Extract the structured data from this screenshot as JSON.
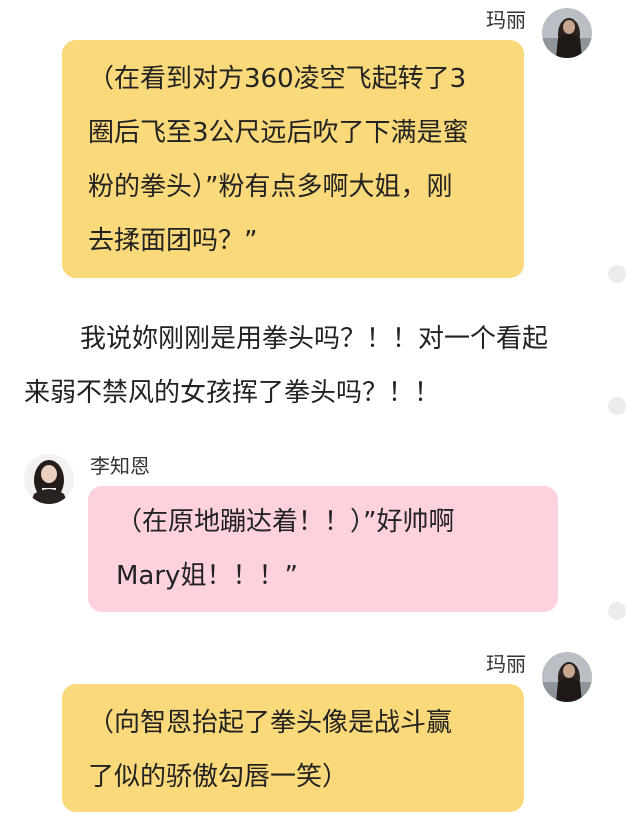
{
  "messages": [
    {
      "sender": "玛丽",
      "lines": [
        "（在看到对方360凌空飞起转了3",
        "圈后飞至3公尺远后吹了下满是蜜",
        "粉的拳头）”粉有点多啊大姐，刚",
        "去揉面团吗？”"
      ]
    },
    {
      "lines": [
        "我说妳刚刚是用拳头吗？！！对一个看起",
        "来弱不禁风的女孩挥了拳头吗？！！"
      ]
    },
    {
      "sender": "李知恩",
      "lines": [
        "（在原地蹦达着！！）”好帅啊",
        "Mary姐！！！”"
      ]
    },
    {
      "sender": "玛丽",
      "lines": [
        "（向智恩抬起了拳头像是战斗赢",
        "了似的骄傲勾唇一笑）"
      ]
    }
  ],
  "colors": {
    "mary_bubble": "#fad97a",
    "jieun_bubble": "#fdd2dc"
  }
}
